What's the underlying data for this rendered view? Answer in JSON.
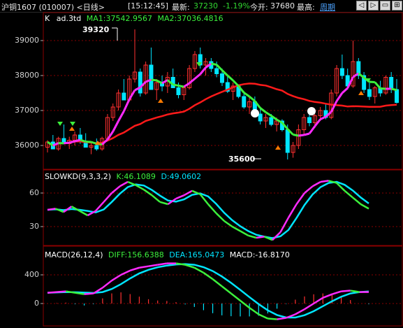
{
  "header": {
    "symbol": "沪铜1607 (010007) <日线>",
    "time": "[15:12:45]",
    "last_label": "最新:",
    "last_value": "37230",
    "change_pct": "-1.19%",
    "open_label": "今开:",
    "open_value": "37680",
    "high_label": "最高:",
    "period_link": "周期"
  },
  "window_buttons": [
    "◁",
    "▷",
    "▭",
    "⊞"
  ],
  "main_panel": {
    "indicator_prefix": "K",
    "indicator_name": "ad.3td",
    "ma1_label": "MA1:37542.9567",
    "ma2_label": "MA2:37036.4816",
    "y_ticks": [
      "39000",
      "38000",
      "37000",
      "36000"
    ],
    "high_note": "39320",
    "low_note": "35600"
  },
  "kd_panel": {
    "title": "SLOWKD(9,3,3,2)",
    "k_label": "K:46.1089",
    "d_label": "D:49.0602",
    "y_ticks": [
      "60",
      "30"
    ]
  },
  "macd_panel": {
    "title": "MACD(26,12,4)",
    "diff_label": "DIFF:156.6388",
    "dea_label": "DEA:165.0473",
    "macd_label": "MACD:-16.8170",
    "y_ticks": [
      "400",
      "0"
    ]
  },
  "colors": {
    "up": "#ff3030",
    "down": "#00e5ff",
    "ma_magenta": "#ff2bff",
    "ma_green": "#3cf03c",
    "ma2_red": "#ff1a1a",
    "grid": "#8a0000"
  }
}
